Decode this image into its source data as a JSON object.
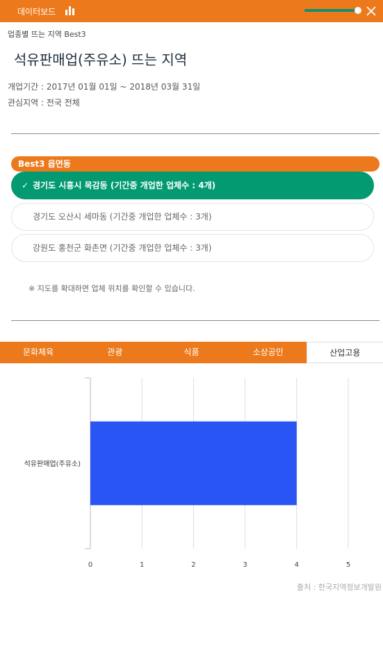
{
  "topbar": {
    "title": "데이터보드",
    "chart_icon": "bar-chart-icon",
    "close_icon": "close-icon"
  },
  "breadcrumb": "업종별 뜨는 지역 Best3",
  "page_title": "석유판매업(주유소) 뜨는 지역",
  "meta": {
    "period": "개업기간 : 2017년 01월 01일 ~ 2018년 03월 31일",
    "region": "관심지역 : 전국 전체"
  },
  "best": {
    "header": "Best3 읍면동",
    "items": [
      {
        "label": "경기도 시흥시 목감동 (기간중 개업한 업체수 : 4개)",
        "selected": true
      },
      {
        "label": "경기도 오산시 세마동 (기간중 개업한 업체수 : 3개)",
        "selected": false
      },
      {
        "label": "강원도 홍천군 화촌면 (기간중 개업한 업체수 : 3개)",
        "selected": false
      }
    ],
    "check_symbol": "✓"
  },
  "note": "※ 지도를 확대하면 업체 위치를 확인할 수 있습니다.",
  "tabs": [
    "문화체육",
    "관광",
    "식품",
    "소상공인",
    "산업고용"
  ],
  "active_tab": "산업고용",
  "colors": {
    "accent": "#ec7a1c",
    "selected": "#039a72",
    "bar": "#2a55f5"
  },
  "chart_data": {
    "type": "bar",
    "orientation": "horizontal",
    "categories": [
      "석유판매업(주유소)"
    ],
    "values": [
      4
    ],
    "xlim": [
      0,
      5
    ],
    "xticks": [
      "0",
      "1",
      "2",
      "3",
      "4",
      "5"
    ],
    "grid": true
  },
  "source": "출처 : 한국지역정보개발원"
}
